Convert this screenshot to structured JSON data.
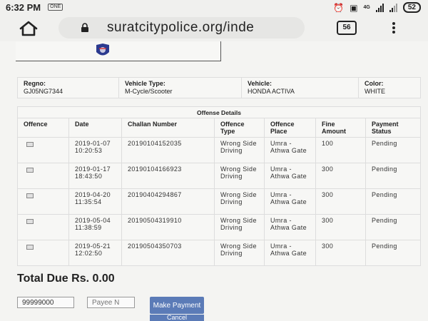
{
  "status_bar": {
    "time": "6:32 PM",
    "notification_badge": "ONE",
    "network_label": "4G",
    "battery_level": "52"
  },
  "browser": {
    "url": "suratcitypolice.org/inde",
    "tab_count": "56"
  },
  "vehicle_info": {
    "regno_label": "Regno:",
    "regno_value": "GJ05NG7344",
    "type_label": "Vehicle Type:",
    "type_value": "M-Cycle/Scooter",
    "vehicle_label": "Vehicle:",
    "vehicle_value": "HONDA ACTIVA",
    "color_label": "Color:",
    "color_value": "WHITE"
  },
  "offense_details": {
    "caption": "Offense Details",
    "headers": [
      "Offence",
      "Date",
      "Challan Number",
      "Offence Type",
      "Offence Place",
      "Fine Amount",
      "Payment Status"
    ],
    "rows": [
      {
        "date": "2019-01-07 10:20:53",
        "challan": "20190104152035",
        "type": "Wrong Side Driving",
        "place": "Umra - Athwa Gate",
        "fine": "100",
        "status": "Pending"
      },
      {
        "date": "2019-01-17 18:43:50",
        "challan": "20190104166923",
        "type": "Wrong Side Driving",
        "place": "Umra - Athwa Gate",
        "fine": "300",
        "status": "Pending"
      },
      {
        "date": "2019-04-20 11:35:54",
        "challan": "20190404294867",
        "type": "Wrong Side Driving",
        "place": "Umra - Athwa Gate",
        "fine": "300",
        "status": "Pending"
      },
      {
        "date": "2019-05-04 11:38:59",
        "challan": "20190504319910",
        "type": "Wrong Side Driving",
        "place": "Umra - Athwa Gate",
        "fine": "300",
        "status": "Pending"
      },
      {
        "date": "2019-05-21 12:02:50",
        "challan": "20190504350703",
        "type": "Wrong Side Driving",
        "place": "Umra - Athwa Gate",
        "fine": "300",
        "status": "Pending"
      }
    ]
  },
  "total_due": "Total Due Rs. 0.00",
  "payment_form": {
    "mobile_value": "99999000",
    "payee_placeholder": "Payee N",
    "make_payment_label": "Make Payment",
    "cancel_label": "Cancel"
  },
  "colors": {
    "button_blue": "#5b7bb7",
    "page_bg": "#f4f4f2"
  }
}
